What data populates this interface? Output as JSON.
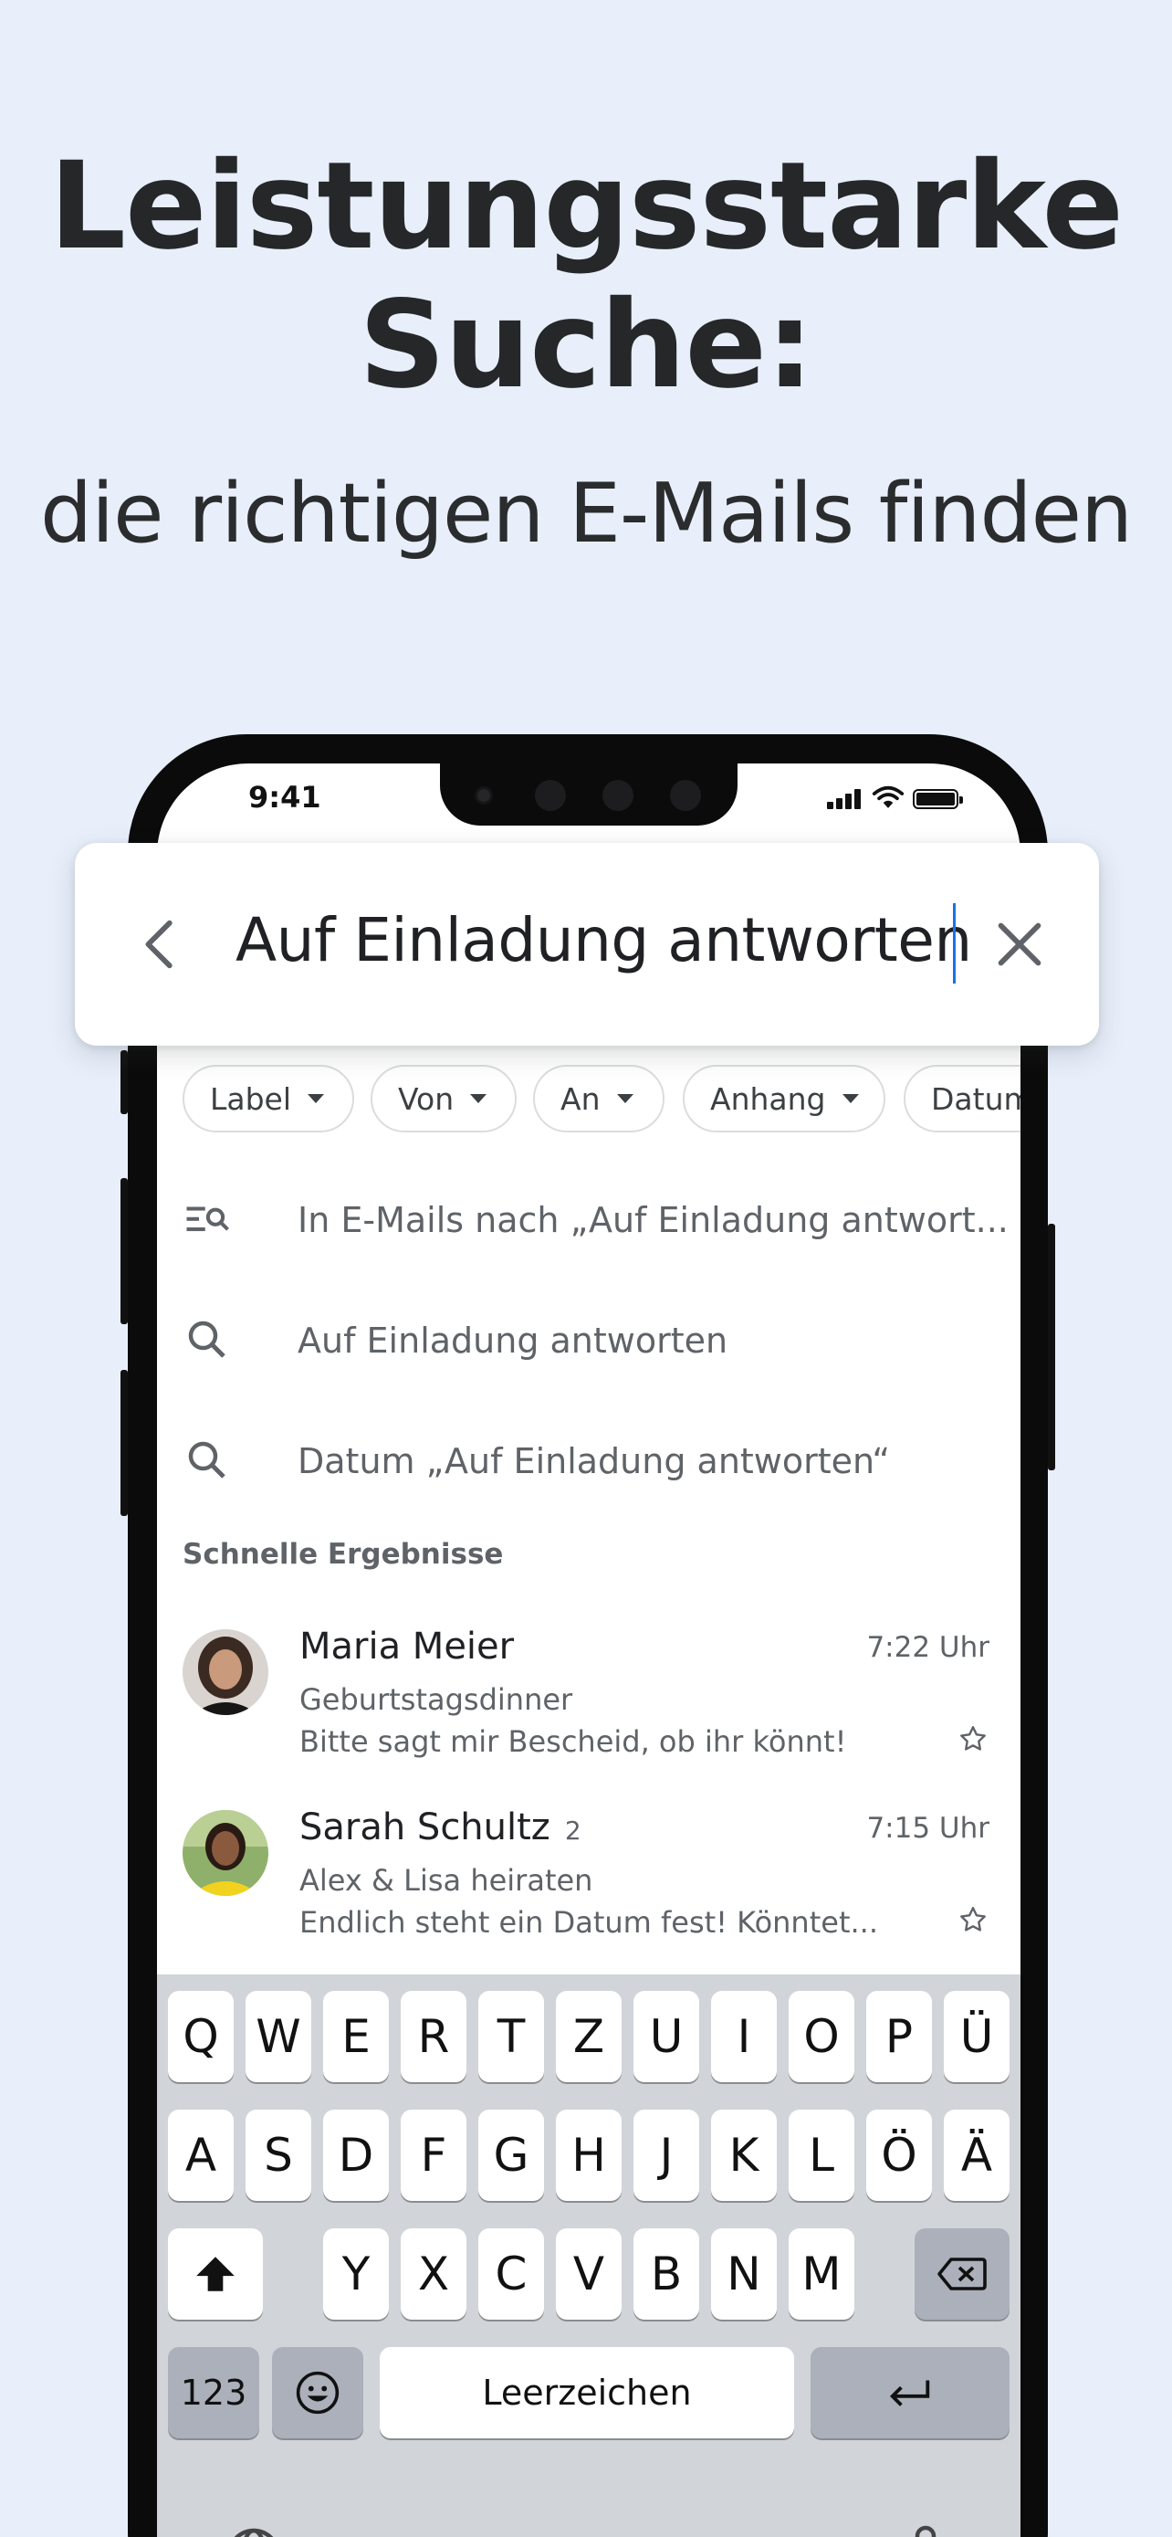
{
  "promo": {
    "title_line1": "Leistungsstarke",
    "title_line2": "Suche:",
    "subtitle": "die richtigen E-Mails finden"
  },
  "status_bar": {
    "time": "9:41"
  },
  "search": {
    "query": "Auf Einladung antworten"
  },
  "filter_chips": [
    {
      "label": "Label"
    },
    {
      "label": "Von"
    },
    {
      "label": "An"
    },
    {
      "label": "Anhang"
    },
    {
      "label": "Datum"
    }
  ],
  "suggestions": [
    {
      "icon": "search-in-mail-icon",
      "text": "In E-Mails nach „Auf Einladung antwort..."
    },
    {
      "icon": "search-icon",
      "text": "Auf Einladung antworten"
    },
    {
      "icon": "search-icon",
      "text": "Datum „Auf Einladung antworten“"
    }
  ],
  "quick_results": {
    "title": "Schnelle Ergebnisse",
    "items": [
      {
        "sender": "Maria Meier",
        "count": "",
        "time": "7:22 Uhr",
        "subject": "Geburtstagsdinner",
        "snippet": "Bitte sagt mir Bescheid, ob ihr könnt!"
      },
      {
        "sender": "Sarah Schultz",
        "count": "2",
        "time": "7:15 Uhr",
        "subject": "Alex & Lisa heiraten",
        "snippet": "Endlich steht ein Datum fest! Könntet..."
      }
    ]
  },
  "keyboard": {
    "row1": [
      "Q",
      "W",
      "E",
      "R",
      "T",
      "Z",
      "U",
      "I",
      "O",
      "P",
      "Ü"
    ],
    "row2": [
      "A",
      "S",
      "D",
      "F",
      "G",
      "H",
      "J",
      "K",
      "L",
      "Ö",
      "Ä"
    ],
    "row3": [
      "Y",
      "X",
      "C",
      "V",
      "B",
      "N",
      "M"
    ],
    "numbers_label": "123",
    "space_label": "Leerzeichen"
  },
  "colors": {
    "background": "#e8effb",
    "accent": "#1a73e8"
  }
}
